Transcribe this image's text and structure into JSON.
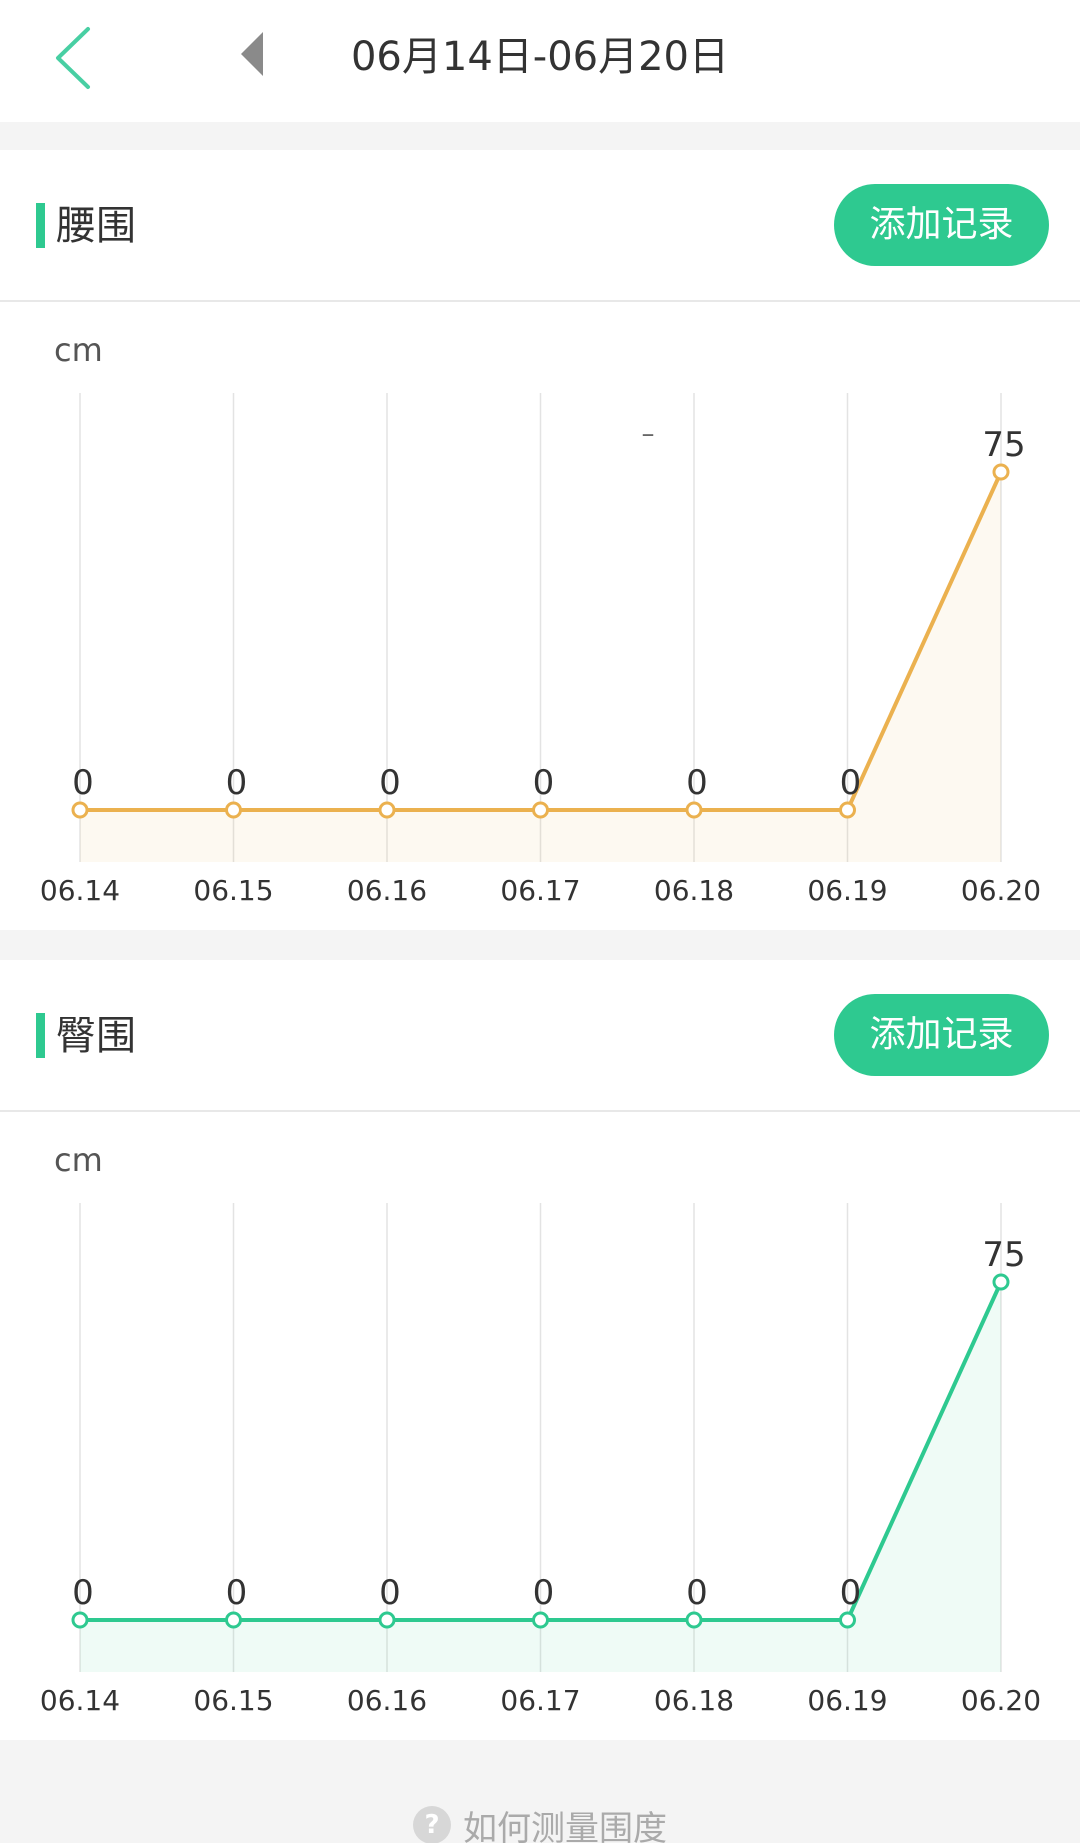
{
  "header": {
    "back_icon": "chevron-left-icon",
    "prev_icon": "triangle-left-icon",
    "date_range": "06月14日-06月20日",
    "accent_color": "#2ec990"
  },
  "cards": [
    {
      "title": "腰围",
      "add_button_label": "添加记录",
      "unit": "cm",
      "accent_color": "#2ec990",
      "line_color": "#ebb14f"
    },
    {
      "title": "臀围",
      "add_button_label": "添加记录",
      "unit": "cm",
      "accent_color": "#2ec990",
      "line_color": "#2ec990"
    }
  ],
  "chart_data": [
    {
      "type": "line",
      "categories": [
        "06.14",
        "06.15",
        "06.16",
        "06.17",
        "06.18",
        "06.19",
        "06.20"
      ],
      "values": [
        0,
        0,
        0,
        0,
        0,
        0,
        75
      ],
      "data_labels": [
        "0",
        "0",
        "0",
        "0",
        "0",
        "0",
        "75"
      ],
      "ylabel": "cm",
      "ylim": [
        0,
        85
      ],
      "grid": "vertical",
      "color": "#ebb14f",
      "extra_mark": "–"
    },
    {
      "type": "line",
      "categories": [
        "06.14",
        "06.15",
        "06.16",
        "06.17",
        "06.18",
        "06.19",
        "06.20"
      ],
      "values": [
        0,
        0,
        0,
        0,
        0,
        0,
        75
      ],
      "data_labels": [
        "0",
        "0",
        "0",
        "0",
        "0",
        "0",
        "75"
      ],
      "ylabel": "cm",
      "ylim": [
        0,
        85
      ],
      "grid": "vertical",
      "color": "#2ec990"
    }
  ],
  "footer": {
    "help_icon": "question-circle-icon",
    "help_text": "如何测量围度"
  }
}
